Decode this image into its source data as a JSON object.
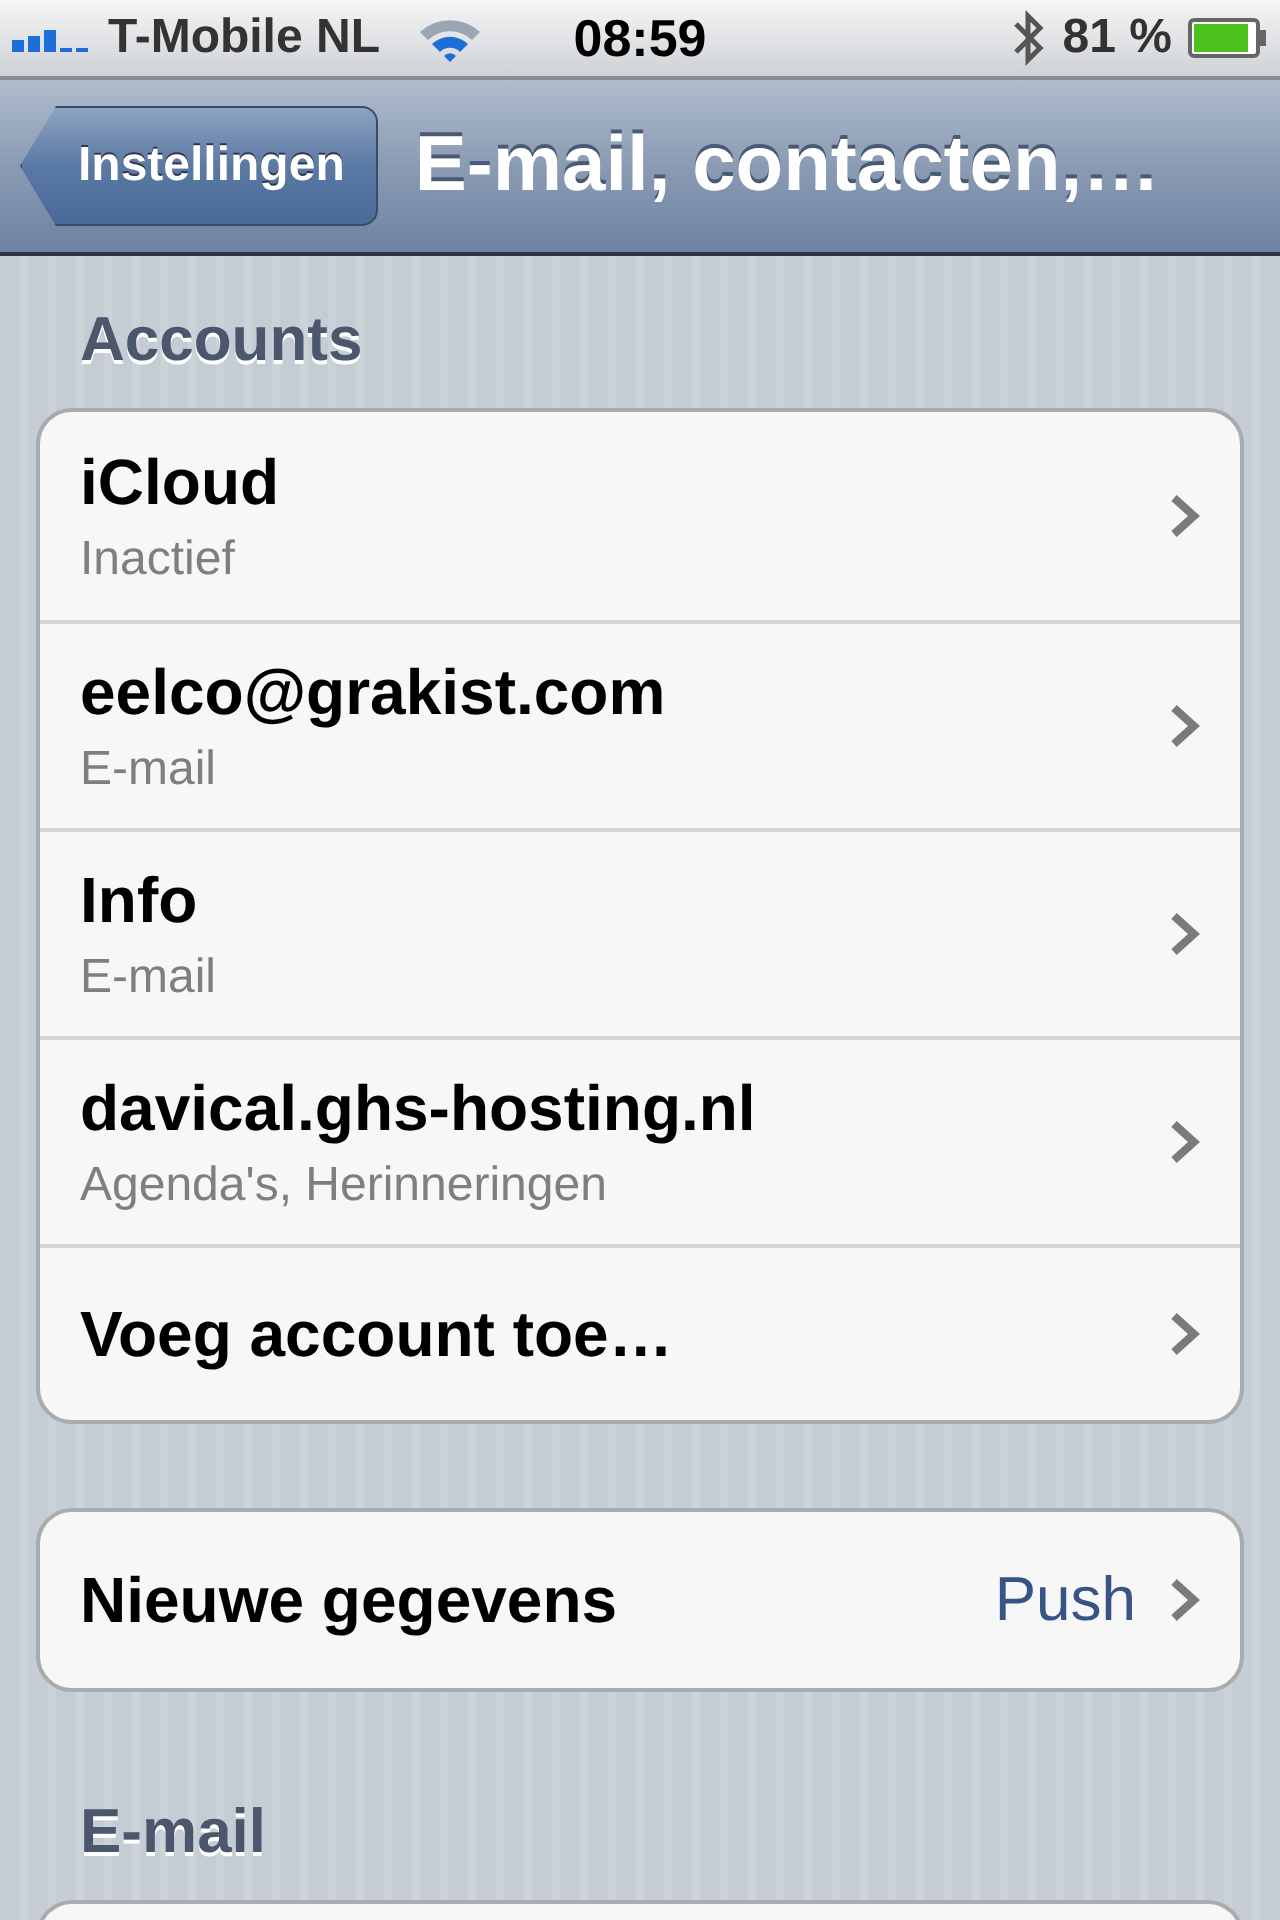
{
  "status_bar": {
    "carrier": "T-Mobile NL",
    "time": "08:59",
    "battery": "81 %"
  },
  "nav_bar": {
    "back_button": "Instellingen",
    "title": "E-mail, contacten,…"
  },
  "sections": [
    {
      "header": "Accounts",
      "rows": [
        {
          "title": "iCloud",
          "subtitle": "Inactief"
        },
        {
          "title": "eelco@grakist.com",
          "subtitle": "E-mail"
        },
        {
          "title": "Info",
          "subtitle": "E-mail"
        },
        {
          "title": "davical.ghs-hosting.nl",
          "subtitle": "Agenda's, Herinneringen"
        },
        {
          "title": "Voeg account toe…"
        }
      ]
    },
    {
      "rows": [
        {
          "title": "Nieuwe gegevens",
          "value": "Push"
        }
      ]
    },
    {
      "header": "E-mail"
    }
  ]
}
